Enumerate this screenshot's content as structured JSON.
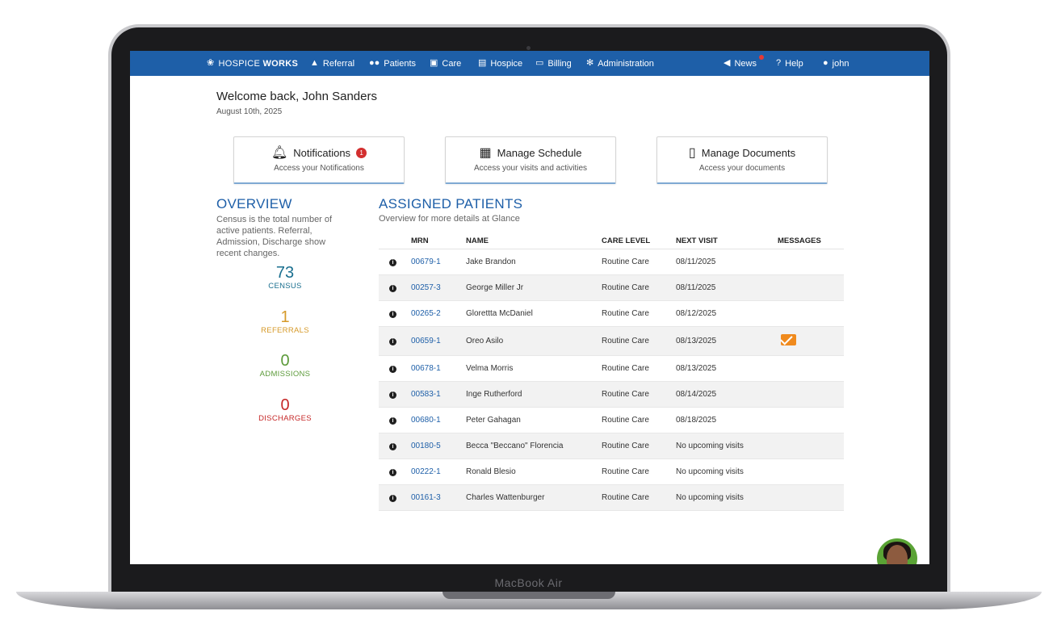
{
  "device": {
    "label": "MacBook Air"
  },
  "nav": {
    "logo": {
      "prefix": "HOSPICE ",
      "suffix": "WORKS"
    },
    "items": [
      {
        "label": "Referral",
        "icon": "road-icon"
      },
      {
        "label": "Patients",
        "icon": "users-icon"
      },
      {
        "label": "Care",
        "icon": "medkit-icon"
      },
      {
        "label": "Hospice",
        "icon": "building-icon"
      },
      {
        "label": "Billing",
        "icon": "money-icon"
      },
      {
        "label": "Administration",
        "icon": "cogs-icon"
      }
    ],
    "right": [
      {
        "label": "News",
        "icon": "megaphone-icon"
      },
      {
        "label": "Help",
        "icon": "question-icon"
      },
      {
        "label": "john",
        "icon": "user-icon"
      }
    ],
    "color": "#1e5fa8"
  },
  "welcome": {
    "title": "Welcome back, John Sanders",
    "date": "August 10th, 2025"
  },
  "cards": [
    {
      "title": "Notifications",
      "badge": "1",
      "subtitle": "Access your Notifications",
      "icon": "bell-icon"
    },
    {
      "title": "Manage Schedule",
      "subtitle": "Access your visits and activities",
      "icon": "calendar-icon"
    },
    {
      "title": "Manage Documents",
      "subtitle": "Access your documents",
      "icon": "document-icon"
    }
  ],
  "overview": {
    "title": "OVERVIEW",
    "description": "Census is the total number of active patients. Referral, Admission, Discharge show recent changes.",
    "stats": [
      {
        "value": "73",
        "label": "CENSUS",
        "color": "#1a6f8f"
      },
      {
        "value": "1",
        "label": "REFERRALS",
        "color": "#d69a2a"
      },
      {
        "value": "0",
        "label": "ADMISSIONS",
        "color": "#5c9a3a"
      },
      {
        "value": "0",
        "label": "DISCHARGES",
        "color": "#c62828"
      }
    ]
  },
  "assigned": {
    "title": "ASSIGNED PATIENTS",
    "subtitle": "Overview for more details at Glance",
    "columns": [
      "",
      "MRN",
      "NAME",
      "CARE LEVEL",
      "NEXT VISIT",
      "MESSAGES"
    ],
    "rows": [
      {
        "mrn": "00679-1",
        "name": "Jake Brandon",
        "care": "Routine Care",
        "next": "08/11/2025",
        "message": false
      },
      {
        "mrn": "00257-3",
        "name": "George Miller Jr",
        "care": "Routine Care",
        "next": "08/11/2025",
        "message": false
      },
      {
        "mrn": "00265-2",
        "name": "Glorettta McDaniel",
        "care": "Routine Care",
        "next": "08/12/2025",
        "message": false
      },
      {
        "mrn": "00659-1",
        "name": "Oreo Asilo",
        "care": "Routine Care",
        "next": "08/13/2025",
        "message": true
      },
      {
        "mrn": "00678-1",
        "name": "Velma Morris",
        "care": "Routine Care",
        "next": "08/13/2025",
        "message": false
      },
      {
        "mrn": "00583-1",
        "name": "Inge Rutherford",
        "care": "Routine Care",
        "next": "08/14/2025",
        "message": false
      },
      {
        "mrn": "00680-1",
        "name": "Peter Gahagan",
        "care": "Routine Care",
        "next": "08/18/2025",
        "message": false
      },
      {
        "mrn": "00180-5",
        "name": "Becca \"Beccano\" Florencia",
        "care": "Routine Care",
        "next": "No upcoming visits",
        "message": false
      },
      {
        "mrn": "00222-1",
        "name": "Ronald Blesio",
        "care": "Routine Care",
        "next": "No upcoming visits",
        "message": false
      },
      {
        "mrn": "00161-3",
        "name": "Charles Wattenburger",
        "care": "Routine Care",
        "next": "No upcoming visits",
        "message": false
      }
    ]
  },
  "chat": {
    "icon": "support-avatar-icon"
  }
}
